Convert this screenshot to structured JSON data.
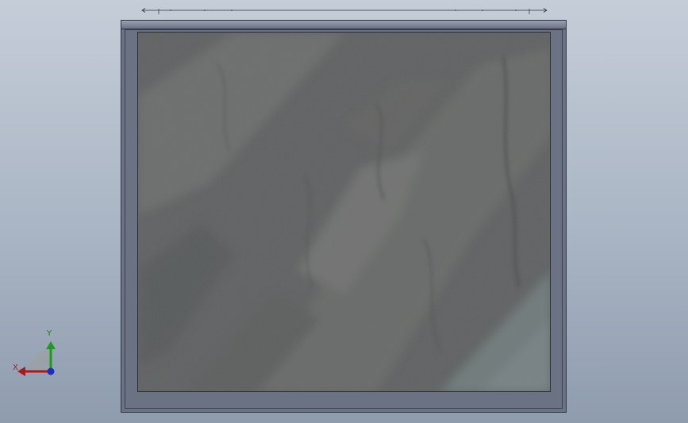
{
  "viewport": {
    "background_top": "#c5cdd8",
    "background_bottom": "#8f9cae"
  },
  "model": {
    "frame_color": "#6a7284",
    "panel_material": "stone",
    "panel_color": "#606464"
  },
  "triad": {
    "x_label": "X",
    "y_label": "Y",
    "x_color": "#b01818",
    "y_color": "#1a9d1a",
    "z_color": "#1a2fc0"
  }
}
